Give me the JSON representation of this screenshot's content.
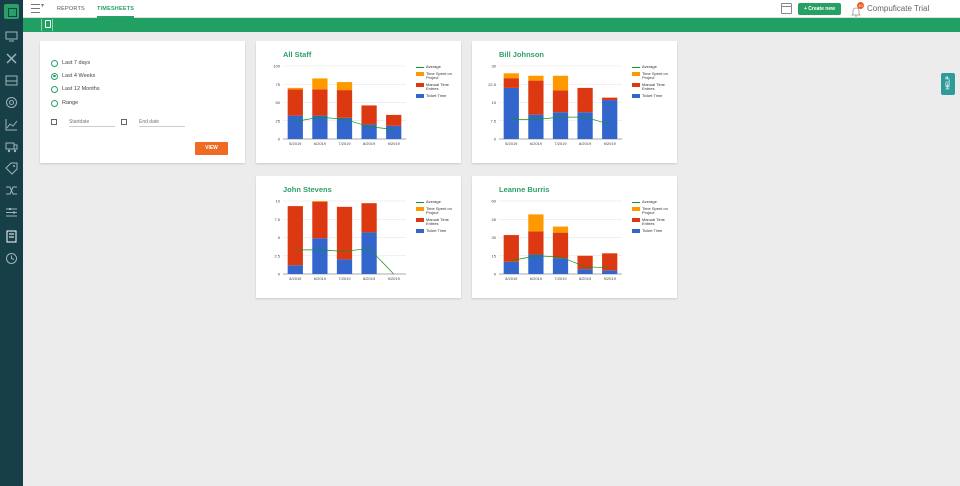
{
  "topbar": {
    "tabs": [
      "REPORTS",
      "TIMESHEETS"
    ],
    "create_label": "+ Create new",
    "notification_count": "10",
    "account_name": "Compuficate Trial"
  },
  "help_label": "HELP",
  "filter": {
    "options": [
      "Last 7 days",
      "Last 4 Weeks",
      "Last 12 Months",
      "Range"
    ],
    "selected": "Last 4 Weeks",
    "start_placeholder": "Startdate",
    "end_placeholder": "End date",
    "view_label": "VIEW"
  },
  "colors": {
    "ticket": "#3366cc",
    "manual": "#dc3912",
    "project": "#ff9900",
    "average": "#109618",
    "brand": "#22a064"
  },
  "icons": [
    "logo-icon",
    "monitor-icon",
    "tools-icon",
    "inbox-icon",
    "target-icon",
    "chart-icon",
    "truck-icon",
    "tag-icon",
    "shuffle-icon",
    "sliders-icon",
    "timesheet-icon",
    "clock-icon"
  ],
  "chart_data": [
    {
      "type": "bar",
      "title": "All Staff",
      "categories": [
        "5/2019",
        "6/2019",
        "7/2019",
        "8/2019",
        "9/2019"
      ],
      "ylim": [
        0,
        100
      ],
      "yticks": [
        "0",
        "25",
        "50",
        "75",
        "100"
      ],
      "stacked": true,
      "series": [
        {
          "name": "Ticket Time",
          "values": [
            32,
            32,
            29,
            20,
            18
          ]
        },
        {
          "name": "Manual Time Entries",
          "values": [
            36,
            36,
            38,
            26,
            15
          ]
        },
        {
          "name": "Time Spent on Project",
          "values": [
            2,
            15,
            11,
            0,
            0
          ]
        },
        {
          "name": "Average",
          "type": "line",
          "values": [
            24,
            30,
            27,
            17,
            13
          ]
        }
      ]
    },
    {
      "type": "bar",
      "title": "Bill Johnson",
      "categories": [
        "5/2019",
        "6/2019",
        "7/2019",
        "8/2019",
        "9/2019"
      ],
      "ylim": [
        0,
        30
      ],
      "yticks": [
        "0",
        "7.5",
        "15",
        "22.5",
        "30"
      ],
      "stacked": true,
      "series": [
        {
          "name": "Ticket Time",
          "values": [
            21,
            10,
            11,
            11,
            16
          ]
        },
        {
          "name": "Manual Time Entries",
          "values": [
            4,
            14,
            9,
            10,
            1
          ]
        },
        {
          "name": "Time Spent on Project",
          "values": [
            2,
            2,
            6,
            0,
            0
          ]
        },
        {
          "name": "Average",
          "type": "line",
          "values": [
            8,
            8,
            9,
            9,
            6
          ]
        }
      ]
    },
    {
      "type": "bar",
      "title": "John Stevens",
      "categories": [
        "5/2019",
        "6/2019",
        "7/2019",
        "8/2019",
        "9/2019"
      ],
      "ylim": [
        0,
        10
      ],
      "yticks": [
        "0",
        "2.5",
        "5",
        "7.5",
        "10"
      ],
      "stacked": true,
      "series": [
        {
          "name": "Ticket Time",
          "values": [
            1.2,
            4.9,
            2.0,
            5.7,
            0
          ]
        },
        {
          "name": "Manual Time Entries",
          "values": [
            8.1,
            5.0,
            7.2,
            4.0,
            0
          ]
        },
        {
          "name": "Time Spent on Project",
          "values": [
            0,
            0.1,
            0,
            0,
            0
          ]
        },
        {
          "name": "Average",
          "type": "line",
          "values": [
            3.3,
            3.3,
            3.1,
            3.5,
            0
          ]
        }
      ]
    },
    {
      "type": "bar",
      "title": "Leanne Burris",
      "categories": [
        "5/2019",
        "6/2019",
        "7/2019",
        "8/2019",
        "9/2019"
      ],
      "ylim": [
        0,
        60
      ],
      "yticks": [
        "0",
        "15",
        "30",
        "45",
        "60"
      ],
      "stacked": true,
      "series": [
        {
          "name": "Ticket Time",
          "values": [
            10,
            16,
            13,
            4,
            3
          ]
        },
        {
          "name": "Manual Time Entries",
          "values": [
            22,
            19,
            21,
            11,
            14
          ]
        },
        {
          "name": "Time Spent on Project",
          "values": [
            0,
            14,
            5,
            0,
            0
          ]
        },
        {
          "name": "Average",
          "type": "line",
          "values": [
            11,
            15,
            14,
            6,
            5
          ]
        }
      ]
    }
  ],
  "legend_labels": [
    "Average",
    "Time Spent on Project",
    "Manual Time Entries",
    "Ticket Time"
  ]
}
